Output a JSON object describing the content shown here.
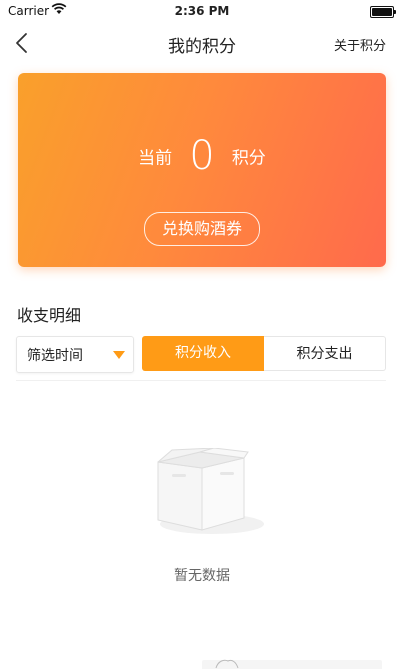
{
  "status_bar": {
    "carrier": "Carrier",
    "time": "2:36 PM"
  },
  "nav": {
    "title": "我的积分",
    "about": "关于积分"
  },
  "card": {
    "current_label": "当前",
    "points": "0",
    "unit_label": "积分",
    "exchange_button": "兑换购酒券"
  },
  "detail": {
    "section_title": "收支明细",
    "filter_label": "筛选时间",
    "tabs": [
      {
        "label": "积分收入",
        "active": true
      },
      {
        "label": "积分支出",
        "active": false
      }
    ],
    "empty_text": "暂无数据"
  },
  "colors": {
    "accent": "#ff9b16",
    "gradient_start": "#f9a02b",
    "gradient_end": "#ff6a4c"
  }
}
